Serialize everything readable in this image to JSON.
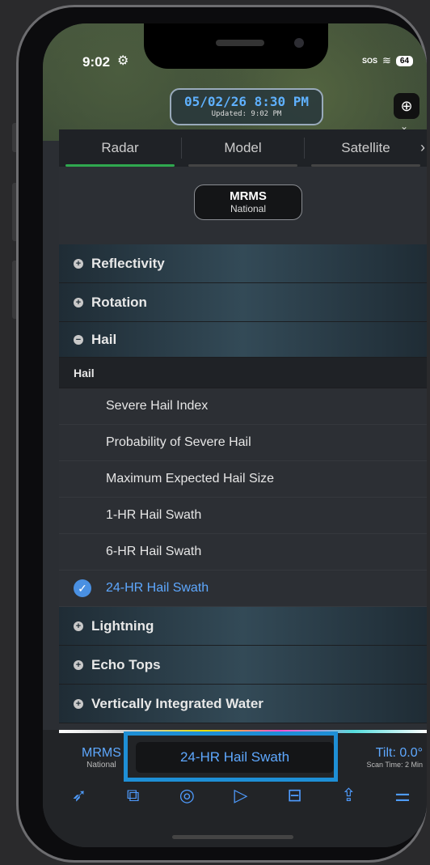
{
  "status_bar": {
    "time": "9:02",
    "sos": "SOS",
    "battery": "64"
  },
  "map": {
    "date": "05/02/26 8:30 PM",
    "updated": "Updated: 9:02 PM"
  },
  "tabs": [
    {
      "label": "Radar",
      "active": true
    },
    {
      "label": "Model",
      "active": false
    },
    {
      "label": "Satellite",
      "active": false
    }
  ],
  "source": {
    "title": "MRMS",
    "subtitle": "National"
  },
  "categories": {
    "reflectivity": "Reflectivity",
    "rotation": "Rotation",
    "hail": "Hail",
    "lightning": "Lightning",
    "echo_tops": "Echo Tops",
    "vil": "Vertically Integrated Water"
  },
  "hail_group": {
    "subheader": "Hail",
    "items": [
      {
        "label": "Severe Hail Index",
        "selected": false
      },
      {
        "label": "Probability of Severe Hail",
        "selected": false
      },
      {
        "label": "Maximum Expected Hail Size",
        "selected": false
      },
      {
        "label": "1-HR Hail Swath",
        "selected": false
      },
      {
        "label": "6-HR Hail Swath",
        "selected": false
      },
      {
        "label": "24-HR Hail Swath",
        "selected": true
      }
    ]
  },
  "bottom": {
    "source_title": "MRMS",
    "source_sub": "National",
    "product": "24-HR Hail Swath",
    "tilt": "Tilt: 0.0°",
    "scan": "Scan Time: 2 Min"
  },
  "toolbar_icons": [
    "location-arrow-icon",
    "layers-icon",
    "radar-icon",
    "play-icon",
    "split-view-icon",
    "share-icon",
    "toggles-icon"
  ],
  "colors": {
    "accent": "#5ea8ff",
    "highlight": "#1e8fd6",
    "active_tab": "#2fa84f"
  }
}
